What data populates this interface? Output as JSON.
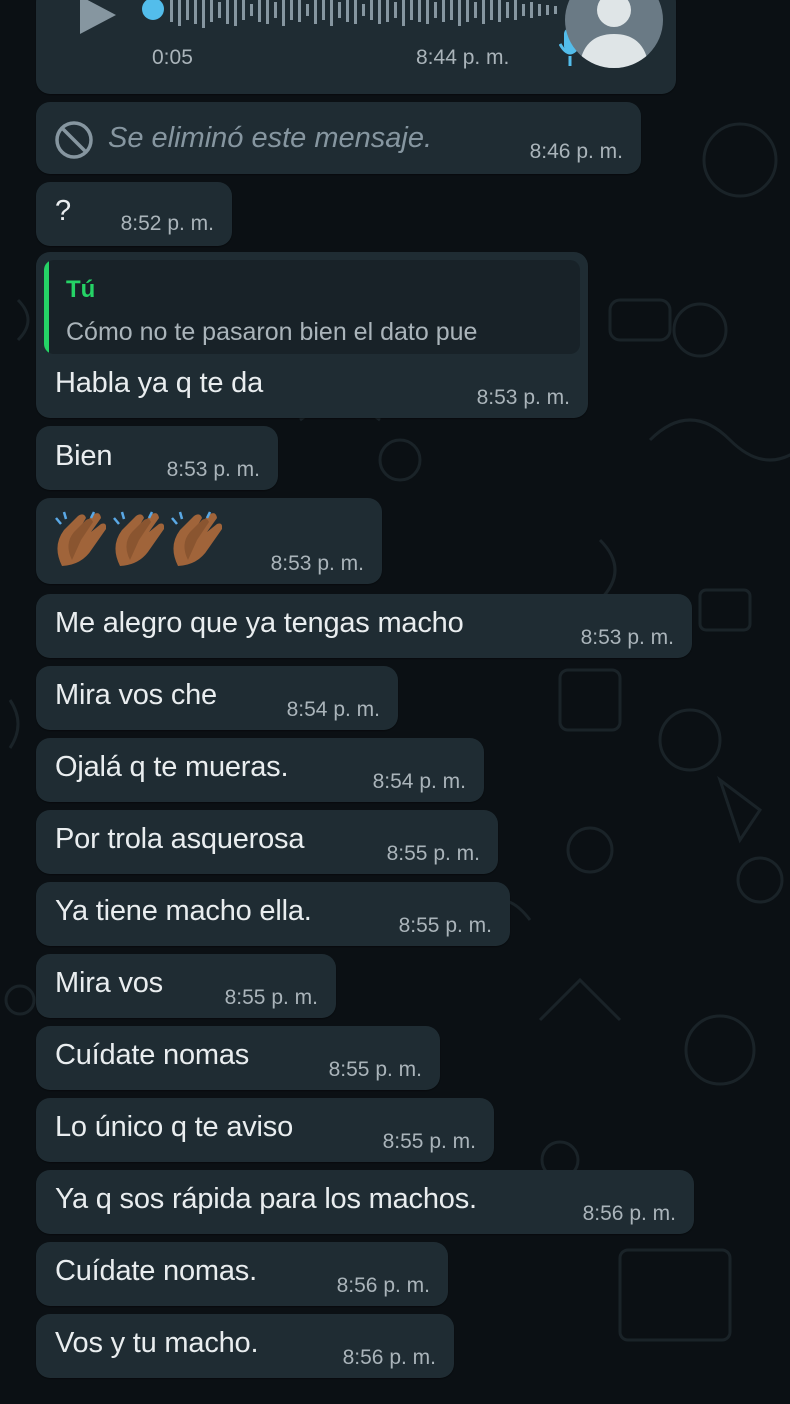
{
  "theme": {
    "background": "#0b1014",
    "bubble": "#1f2c33",
    "quote_bg": "#182228",
    "accent_green": "#25d366",
    "accent_blue": "#53bdeb",
    "meta_text": "#aab4ba"
  },
  "audio_message": {
    "duration": "0:05",
    "time": "8:44 p. m.",
    "progress": 0.0
  },
  "deleted_message": {
    "text": "Se eliminó este mensaje.",
    "time": "8:46 p. m."
  },
  "messages": [
    {
      "text": "?",
      "time": "8:52 p. m."
    },
    {
      "quote_author": "Tú",
      "quote_text": "Cómo no te pasaron bien el dato pue",
      "text": "Habla ya q te da",
      "time": "8:53 p. m."
    },
    {
      "text": "Bien",
      "time": "8:53 p. m."
    },
    {
      "emoji": "clapping-hands x3",
      "time": "8:53 p. m."
    },
    {
      "text": "Me alegro que ya tengas macho",
      "time": "8:53 p. m."
    },
    {
      "text": "Mira vos che",
      "time": "8:54 p. m."
    },
    {
      "text": "Ojalá q te mueras.",
      "time": "8:54 p. m."
    },
    {
      "text": "Por trola asquerosa",
      "time": "8:55 p. m."
    },
    {
      "text": "Ya tiene macho ella.",
      "time": "8:55 p. m."
    },
    {
      "text": "Mira vos",
      "time": "8:55 p. m."
    },
    {
      "text": "Cuídate nomas",
      "time": "8:55 p. m."
    },
    {
      "text": "Lo único q te aviso",
      "time": "8:55 p. m."
    },
    {
      "text": "Ya q sos rápida para los machos.",
      "time": "8:56 p. m."
    },
    {
      "text": "Cuídate nomas.",
      "time": "8:56 p. m."
    },
    {
      "text": "Vos y tu macho.",
      "time": "8:56 p. m."
    }
  ]
}
